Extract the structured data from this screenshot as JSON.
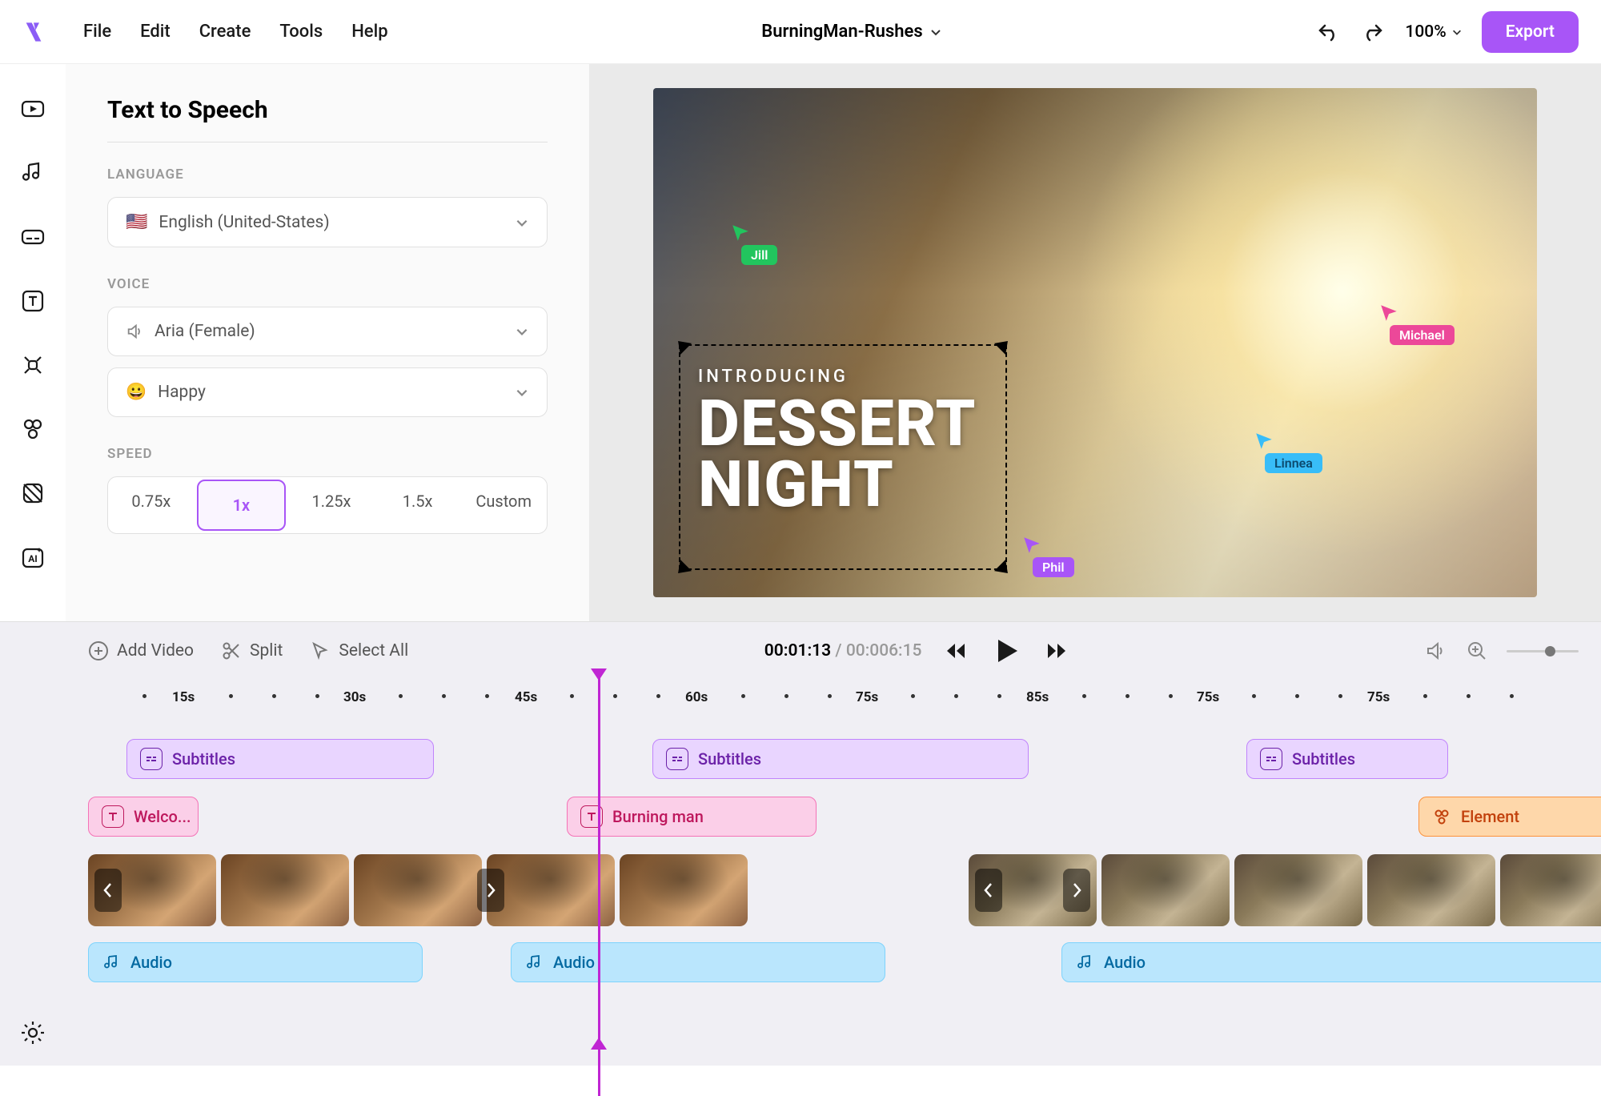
{
  "menu": {
    "file": "File",
    "edit": "Edit",
    "create": "Create",
    "tools": "Tools",
    "help": "Help"
  },
  "project": {
    "title": "BurningMan-Rushes"
  },
  "zoom": "100%",
  "export": "Export",
  "panel": {
    "title": "Text to Speech",
    "language_label": "LANGUAGE",
    "language_value": "English (United-States)",
    "voice_label": "VOICE",
    "voice_value": "Aria (Female)",
    "mood_value": "Happy",
    "speed_label": "SPEED",
    "speeds": {
      "s1": "0.75x",
      "s2": "1x",
      "s3": "1.25x",
      "s4": "1.5x",
      "s5": "Custom"
    }
  },
  "overlay": {
    "intro": "INTRODUCING",
    "line1": "DESSERT",
    "line2": "NIGHT"
  },
  "collab": {
    "jill": "Jill",
    "michael": "Michael",
    "linnea": "Linnea",
    "phil": "Phil"
  },
  "toolbar": {
    "add_video": "Add Video",
    "split": "Split",
    "select_all": "Select All"
  },
  "time": {
    "current": "00:01:13",
    "sep": "/",
    "total": "00:006:15"
  },
  "ruler": [
    "15s",
    "30s",
    "45s",
    "60s",
    "75s",
    "85s",
    "75s",
    "75s"
  ],
  "clips": {
    "subtitles": "Subtitles",
    "welco": "Welco...",
    "burning": "Burning man",
    "element": "Element",
    "audio": "Audio"
  }
}
